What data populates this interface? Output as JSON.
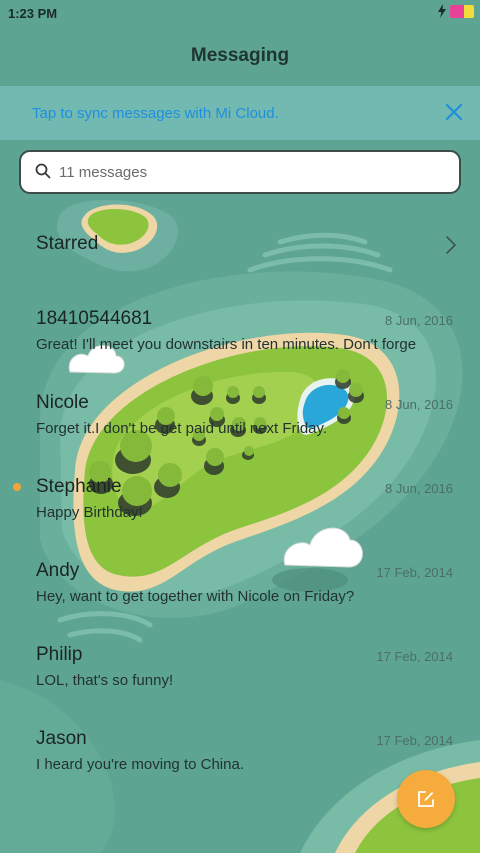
{
  "status_bar": {
    "time": "1:23 PM"
  },
  "header": {
    "title": "Messaging"
  },
  "sync_banner": {
    "text": "Tap to sync messages with Mi Cloud.",
    "close_icon": "close-icon"
  },
  "search": {
    "placeholder": "11 messages",
    "value": ""
  },
  "starred": {
    "label": "Starred"
  },
  "conversations": [
    {
      "name": "18410544681",
      "date": "8 Jun, 2016",
      "preview": "Great! I'll meet you downstairs in ten minutes. Don't forge",
      "unread": false
    },
    {
      "name": "Nicole",
      "date": "8 Jun, 2016",
      "preview": "Forget it.I don't be get paid until next Friday.",
      "unread": false
    },
    {
      "name": "Stephanie",
      "date": "8 Jun, 2016",
      "preview": "Happy Birthday!",
      "unread": true
    },
    {
      "name": "Andy",
      "date": "17 Feb, 2014",
      "preview": "Hey, want to get together with Nicole on Friday?",
      "unread": false
    },
    {
      "name": "Philip",
      "date": "17 Feb, 2014",
      "preview": "LOL, that's so funny!",
      "unread": false
    },
    {
      "name": "Jason",
      "date": "17 Feb, 2014",
      "preview": "I heard you're moving to China.",
      "unread": false
    }
  ],
  "fab": {
    "icon": "compose-icon"
  },
  "colors": {
    "background": "#5da592",
    "accent": "#f5ac3c",
    "link": "#1f8fe0",
    "unread_dot": "#f2a33a"
  }
}
